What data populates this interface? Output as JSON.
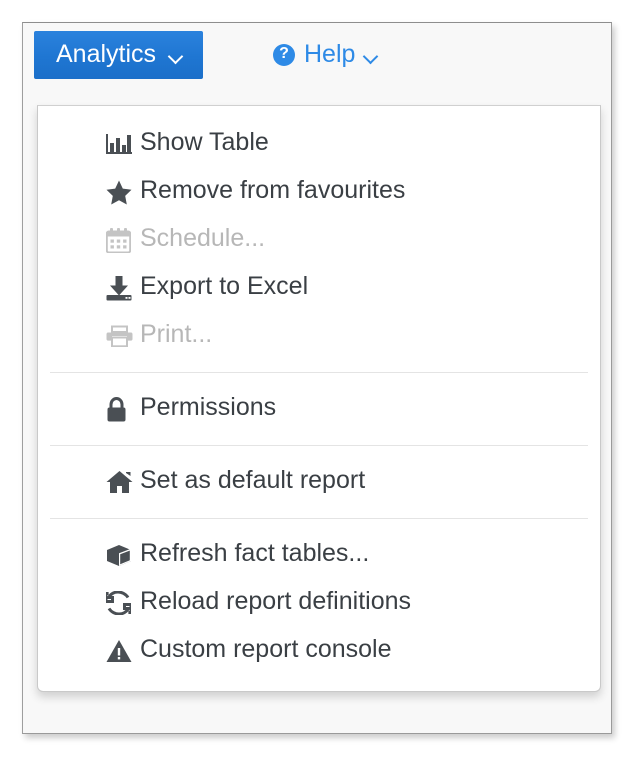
{
  "toolbar": {
    "analytics_button": {
      "label": "Analytics",
      "icon": "chevron-down-icon",
      "color": "#1f76d2",
      "text_color": "#ffffff"
    },
    "help_link": {
      "label": "Help",
      "icon": "question-circle-icon",
      "caret": "chevron-down-icon",
      "color": "#2e8ae6"
    }
  },
  "menu": {
    "name": "analytics-menu",
    "groups": [
      {
        "items": [
          {
            "label": "Show Table",
            "icon": "bar-chart-icon",
            "disabled": false
          },
          {
            "label": "Remove from favourites",
            "icon": "star-icon",
            "disabled": false
          },
          {
            "label": "Schedule...",
            "icon": "calendar-icon",
            "disabled": true
          },
          {
            "label": "Export to Excel",
            "icon": "download-icon",
            "disabled": false
          },
          {
            "label": "Print...",
            "icon": "printer-icon",
            "disabled": true
          }
        ]
      },
      {
        "items": [
          {
            "label": "Permissions",
            "icon": "lock-icon",
            "disabled": false
          }
        ]
      },
      {
        "items": [
          {
            "label": "Set as default report",
            "icon": "home-icon",
            "disabled": false
          }
        ]
      },
      {
        "items": [
          {
            "label": "Refresh fact tables...",
            "icon": "cube-icon",
            "disabled": false
          },
          {
            "label": "Reload report definitions",
            "icon": "refresh-icon",
            "disabled": false
          },
          {
            "label": "Custom report console",
            "icon": "warning-triangle-icon",
            "disabled": false
          }
        ]
      }
    ]
  },
  "colors": {
    "accent": "#1f76d2",
    "link": "#2e8ae6",
    "text": "#3a3f44",
    "disabled_text": "#b7b7b7",
    "separator": "#e4e4e4",
    "panel_bg": "#ffffff",
    "frame_bg": "#f8f8f8"
  }
}
